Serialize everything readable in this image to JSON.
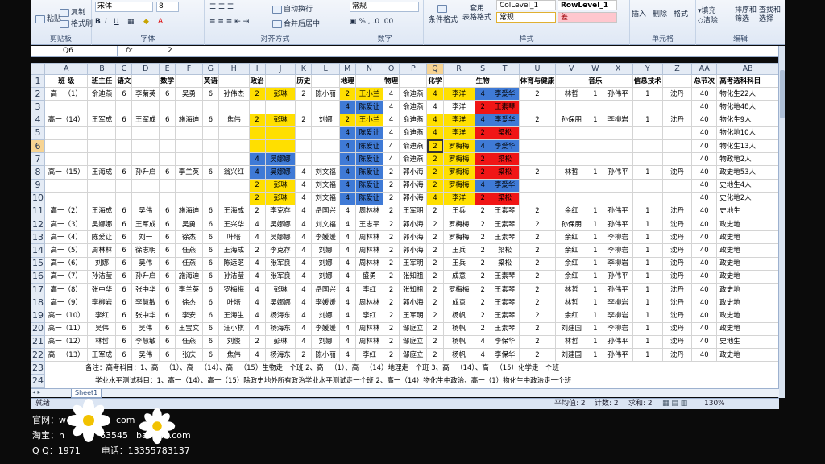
{
  "ribbon": {
    "paste": "粘贴",
    "copy": "复制",
    "format_painter": "格式刷",
    "clipboard": "剪贴板",
    "font_name": "宋体",
    "font_size": "8",
    "font_group": "字体",
    "wrap": "自动换行",
    "merge": "合并后居中",
    "align_group": "对齐方式",
    "number_format": "常规",
    "number_group": "数字",
    "cond_format": "条件格式",
    "table_format": "套用\n表格格式",
    "style1": "ColLevel_1",
    "style2": "RowLevel_1",
    "style3": "常规",
    "style4": "差",
    "style_group": "样式",
    "insert": "插入",
    "delete": "删除",
    "format": "格式",
    "cells_group": "单元格",
    "fill": "填充",
    "clear": "清除",
    "sort": "排序和\n筛选",
    "find": "查找和\n选择",
    "edit_group": "编辑"
  },
  "formula_bar": {
    "name_box": "Q6",
    "fx": "fx",
    "value": "2"
  },
  "columns": [
    "A",
    "B",
    "C",
    "D",
    "E",
    "F",
    "G",
    "H",
    "I",
    "J",
    "K",
    "L",
    "M",
    "N",
    "O",
    "P",
    "Q",
    "R",
    "S",
    "T",
    "U",
    "V",
    "W",
    "X",
    "Y",
    "Z",
    "AA",
    "AB"
  ],
  "rows": [
    [
      "班 级",
      "班主任",
      "语文",
      "",
      "数学",
      "",
      "英语",
      "",
      "政治",
      "",
      "历史",
      "",
      "地理",
      "",
      "物理",
      "",
      "化学",
      "",
      "生物",
      "",
      "体育与健康",
      "",
      "音乐",
      "",
      "信息技术",
      "",
      "总节次",
      "高考选科科目"
    ],
    [
      "高一（1）",
      "俞迪燕",
      "6",
      "李菊英",
      "6",
      "吴勇",
      "6",
      "孙伟杰",
      "2",
      "彭琳",
      "2",
      "陈小丽",
      "2",
      "王小兰",
      "4",
      "俞迪燕",
      "4",
      "李洋",
      "4",
      "李爱华",
      "2",
      "林哲",
      "1",
      "孙伟平",
      "1",
      "沈丹",
      "40",
      "物化生22人"
    ],
    [
      "",
      "",
      "",
      "",
      "",
      "",
      "",
      "",
      "",
      "",
      "",
      "",
      "4",
      "陈爱让",
      "4",
      "俞迪燕",
      "4",
      "李洋",
      "2",
      "王素琴",
      "",
      "",
      "",
      "",
      "",
      "",
      "40",
      "物化地48人"
    ],
    [
      "高一（14）",
      "王军成",
      "6",
      "王军成",
      "6",
      "施海迪",
      "6",
      "焦伟",
      "2",
      "彭琳",
      "2",
      "刘娜",
      "2",
      "王小兰",
      "4",
      "俞迪燕",
      "4",
      "李洋",
      "4",
      "李爱华",
      "2",
      "孙保朋",
      "1",
      "李柳岩",
      "1",
      "沈丹",
      "40",
      "物化生9人"
    ],
    [
      "",
      "",
      "",
      "",
      "",
      "",
      "",
      "",
      "",
      "",
      "",
      "",
      "4",
      "陈爱让",
      "4",
      "俞迪燕",
      "4",
      "李洋",
      "2",
      "梁松",
      "",
      "",
      "",
      "",
      "",
      "",
      "40",
      "物化地10人"
    ],
    [
      "",
      "",
      "",
      "",
      "",
      "",
      "",
      "",
      "",
      "",
      "",
      "",
      "4",
      "陈爱让",
      "4",
      "俞迪燕",
      "2",
      "罗梅梅",
      "4",
      "李爱华",
      "",
      "",
      "",
      "",
      "",
      "",
      "40",
      "物化生13人"
    ],
    [
      "",
      "",
      "",
      "",
      "",
      "",
      "",
      "",
      "4",
      "吴娜娜",
      "",
      "",
      "4",
      "陈爱让",
      "4",
      "俞迪燕",
      "2",
      "罗梅梅",
      "2",
      "梁松",
      "",
      "",
      "",
      "",
      "",
      "",
      "40",
      "物政地2人"
    ],
    [
      "高一（15）",
      "王海成",
      "6",
      "孙升启",
      "6",
      "李兰英",
      "6",
      "翁兴红",
      "4",
      "吴娜娜",
      "4",
      "刘文福",
      "4",
      "陈爱让",
      "2",
      "郭小海",
      "2",
      "罗梅梅",
      "2",
      "梁松",
      "2",
      "林哲",
      "1",
      "孙伟平",
      "1",
      "沈丹",
      "40",
      "政史地53人"
    ],
    [
      "",
      "",
      "",
      "",
      "",
      "",
      "",
      "",
      "2",
      "彭琳",
      "4",
      "刘文福",
      "4",
      "陈爱让",
      "2",
      "郭小海",
      "2",
      "罗梅梅",
      "4",
      "李爱华",
      "",
      "",
      "",
      "",
      "",
      "",
      "40",
      "史地生4人"
    ],
    [
      "",
      "",
      "",
      "",
      "",
      "",
      "",
      "",
      "2",
      "彭琳",
      "4",
      "刘文福",
      "4",
      "陈爱让",
      "2",
      "郭小海",
      "4",
      "李洋",
      "2",
      "梁松",
      "",
      "",
      "",
      "",
      "",
      "",
      "40",
      "史化地2人"
    ],
    [
      "高一（2）",
      "王海成",
      "6",
      "吴伟",
      "6",
      "施海迪",
      "6",
      "王海成",
      "2",
      "李克存",
      "4",
      "岳国兴",
      "4",
      "周林林",
      "2",
      "王军明",
      "2",
      "王兵",
      "2",
      "王素琴",
      "2",
      "余红",
      "1",
      "孙伟平",
      "1",
      "沈丹",
      "40",
      "史地生"
    ],
    [
      "高一（3）",
      "吴娜娜",
      "6",
      "王军成",
      "6",
      "吴勇",
      "6",
      "王兴华",
      "4",
      "吴娜娜",
      "4",
      "刘文福",
      "4",
      "王志平",
      "2",
      "郭小海",
      "2",
      "罗梅梅",
      "2",
      "王素琴",
      "2",
      "孙保朋",
      "1",
      "孙伟平",
      "1",
      "沈丹",
      "40",
      "政史地"
    ],
    [
      "高一（4）",
      "陈爱让",
      "6",
      "刘一",
      "6",
      "徐杰",
      "6",
      "叶培",
      "4",
      "吴娜娜",
      "4",
      "李媛媛",
      "4",
      "周林林",
      "2",
      "郭小海",
      "2",
      "罗梅梅",
      "2",
      "王素琴",
      "2",
      "余红",
      "1",
      "李柳岩",
      "1",
      "沈丹",
      "40",
      "政史地"
    ],
    [
      "高一（5）",
      "周林林",
      "6",
      "徐志明",
      "6",
      "任燕",
      "6",
      "王海成",
      "2",
      "李克存",
      "4",
      "刘娜",
      "4",
      "周林林",
      "2",
      "郭小海",
      "2",
      "王兵",
      "2",
      "梁松",
      "2",
      "余红",
      "1",
      "李柳岩",
      "1",
      "沈丹",
      "40",
      "政史地"
    ],
    [
      "高一（6）",
      "刘娜",
      "6",
      "吴伟",
      "6",
      "任燕",
      "6",
      "陈远芝",
      "4",
      "张军良",
      "4",
      "刘娜",
      "4",
      "周林林",
      "2",
      "王军明",
      "2",
      "王兵",
      "2",
      "梁松",
      "2",
      "余红",
      "1",
      "李柳岩",
      "1",
      "沈丹",
      "40",
      "政史地"
    ],
    [
      "高一（7）",
      "孙洁莹",
      "6",
      "孙升启",
      "6",
      "施海迪",
      "6",
      "孙洁莹",
      "4",
      "张军良",
      "4",
      "刘娜",
      "4",
      "盛勇",
      "2",
      "张知祖",
      "2",
      "成意",
      "2",
      "王素琴",
      "2",
      "余红",
      "1",
      "孙伟平",
      "1",
      "沈丹",
      "40",
      "政史地"
    ],
    [
      "高一（8）",
      "张中华",
      "6",
      "张中华",
      "6",
      "李兰英",
      "6",
      "罗梅梅",
      "4",
      "彭琳",
      "4",
      "岳国兴",
      "4",
      "李红",
      "2",
      "张知祖",
      "2",
      "罗梅梅",
      "2",
      "王素琴",
      "2",
      "林哲",
      "1",
      "孙伟平",
      "1",
      "沈丹",
      "40",
      "政史地"
    ],
    [
      "高一（9）",
      "李柳岩",
      "6",
      "李慧敏",
      "6",
      "徐杰",
      "6",
      "叶培",
      "4",
      "吴娜娜",
      "4",
      "李媛媛",
      "4",
      "周林林",
      "2",
      "郭小海",
      "2",
      "成意",
      "2",
      "王素琴",
      "2",
      "林哲",
      "1",
      "李柳岩",
      "1",
      "沈丹",
      "40",
      "政史地"
    ],
    [
      "高一（10）",
      "李红",
      "6",
      "张中华",
      "6",
      "李安",
      "6",
      "王海生",
      "4",
      "杨海东",
      "4",
      "刘娜",
      "4",
      "李红",
      "2",
      "王军明",
      "2",
      "杨帆",
      "2",
      "王素琴",
      "2",
      "余红",
      "1",
      "李柳岩",
      "1",
      "沈丹",
      "40",
      "政史地"
    ],
    [
      "高一（11）",
      "吴伟",
      "6",
      "吴伟",
      "6",
      "王宝文",
      "6",
      "汪小棋",
      "4",
      "杨海东",
      "4",
      "李媛媛",
      "4",
      "周林林",
      "2",
      "邹庭立",
      "2",
      "杨帆",
      "2",
      "王素琴",
      "2",
      "刘建国",
      "1",
      "李柳岩",
      "1",
      "沈丹",
      "40",
      "政史地"
    ],
    [
      "高一（12）",
      "林哲",
      "6",
      "李慧敏",
      "6",
      "任燕",
      "6",
      "刘俊",
      "2",
      "彭琳",
      "4",
      "刘娜",
      "4",
      "周林林",
      "2",
      "邹庭立",
      "2",
      "杨帆",
      "4",
      "李保华",
      "2",
      "林哲",
      "1",
      "孙伟平",
      "1",
      "沈丹",
      "40",
      "史地生"
    ],
    [
      "高一（13）",
      "王军成",
      "6",
      "吴伟",
      "6",
      "张庆",
      "6",
      "焦伟",
      "4",
      "杨海东",
      "2",
      "陈小丽",
      "4",
      "李红",
      "2",
      "邹庭立",
      "2",
      "杨帆",
      "4",
      "李保华",
      "2",
      "刘建国",
      "1",
      "孙伟平",
      "1",
      "沈丹",
      "40",
      "政史地"
    ]
  ],
  "notes": [
    "备注：高考科目：1、高一（1）、高一（14）、高一（15）生物走一个班    2、高一（1）、高一（14）地理走一个班        3、高一（14）、高一（15）化学走一个班",
    "学业水平测试科目：1、高一（14）、高一（15）除政史地外所有政治学业水平测试走一个班    2、高一（14）物化生中政治、高一（1）物化生中政治走一个班"
  ],
  "sheet_tab": "Sheet1",
  "status": {
    "ready": "就绪",
    "average": "平均值: 2",
    "count": "计数: 2",
    "sum": "求和: 2",
    "zoom": "130%"
  },
  "promo": {
    "line1": "官网：w",
    "line1b": "com",
    "line2": "淘宝：h",
    "line2b": "63545",
    "line2c": "baobao.com",
    "line3": "Q Q：1971",
    "line3b": "电话：13355783137"
  }
}
